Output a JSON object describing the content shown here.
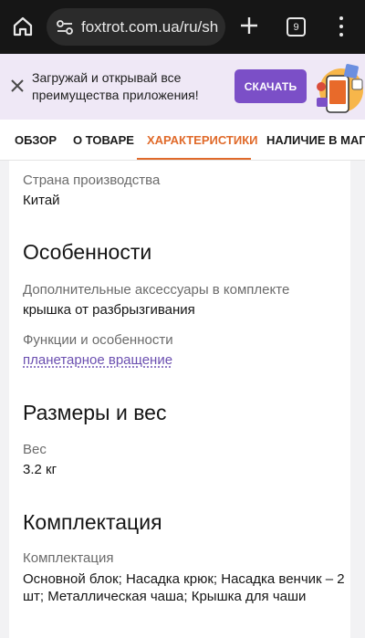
{
  "browser": {
    "url": "foxtrot.com.ua/ru/sh",
    "tab_count": "9",
    "icons": [
      "home-icon",
      "site-settings-icon",
      "new-tab-plus-icon",
      "tab-switcher-icon",
      "more-menu-icon"
    ]
  },
  "app_banner": {
    "text": "Загружай и открывай все преимущества приложения!",
    "button_label": "СКАЧАТЬ",
    "accent_color": "#7b4fc7"
  },
  "tabs": [
    {
      "label": "ОБЗОР",
      "active": false
    },
    {
      "label": "О ТОВАРЕ",
      "active": false
    },
    {
      "label": "ХАРАКТЕРИСТИКИ",
      "active": true
    },
    {
      "label": "НАЛИЧИЕ В МАГАЗ",
      "active": false
    }
  ],
  "active_tab_color": "#e06a2a",
  "specs": {
    "country": {
      "label": "Страна производства",
      "value": "Китай"
    },
    "features_title": "Особенности",
    "accessories": {
      "label": "Дополнительные аксессуары в комплекте",
      "value": "крышка от разбрызгивания"
    },
    "functions": {
      "label": "Функции и особенности",
      "value": "планетарное вращение"
    },
    "size_title": "Размеры и вес",
    "weight": {
      "label": "Вес",
      "value": "3.2 кг"
    },
    "package_title": "Комплектация",
    "package": {
      "label": "Комплектация",
      "value": "Основной блок; Насадка крюк; Насадка венчик – 2 шт; Металлическая чаша; Крышка для чаши"
    }
  }
}
